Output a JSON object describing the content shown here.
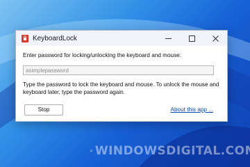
{
  "window": {
    "title": "KeyboardLock",
    "app_icon": "lock-app-icon"
  },
  "titlebar_buttons": {
    "minimize_icon": "minimize-icon",
    "maximize_icon": "maximize-icon",
    "close_icon": "close-icon"
  },
  "form": {
    "prompt": "Enter password for locking/unlocking the keyboard and mouse:",
    "password_value": "asimplepassword",
    "instructions": "Type the password to lock the keyboard and mouse. To unlock the mouse and keyboard later, type the password again."
  },
  "actions": {
    "stop_label": "Stop",
    "about_label": "About this app ..."
  },
  "watermark": {
    "text": "WINDOWSDIGITAL.COM"
  },
  "colors": {
    "accent_link": "#0645ad",
    "icon_red": "#d83b2b",
    "desktop_blue": "#1760d6"
  }
}
